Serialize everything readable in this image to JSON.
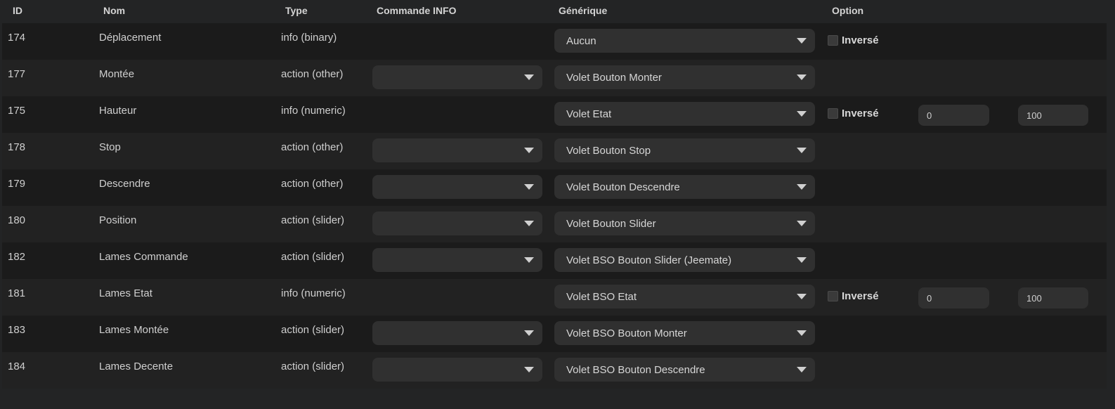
{
  "headers": {
    "id": "ID",
    "nom": "Nom",
    "type": "Type",
    "commande": "Commande INFO",
    "generique": "Générique",
    "option": "Option"
  },
  "rows": [
    {
      "id": "174",
      "nom": "Déplacement",
      "type": "info (binary)",
      "generique": "Aucun",
      "inverse_label": "Inversé"
    },
    {
      "id": "177",
      "nom": "Montée",
      "type": "action (other)",
      "commande": "",
      "generique": "Volet Bouton Monter"
    },
    {
      "id": "175",
      "nom": "Hauteur",
      "type": "info (numeric)",
      "generique": "Volet Etat",
      "inverse_label": "Inversé",
      "min": "0",
      "max": "100"
    },
    {
      "id": "178",
      "nom": "Stop",
      "type": "action (other)",
      "commande": "",
      "generique": "Volet Bouton Stop"
    },
    {
      "id": "179",
      "nom": "Descendre",
      "type": "action (other)",
      "commande": "",
      "generique": "Volet Bouton Descendre"
    },
    {
      "id": "180",
      "nom": "Position",
      "type": "action (slider)",
      "commande": "",
      "generique": "Volet Bouton Slider"
    },
    {
      "id": "182",
      "nom": "Lames Commande",
      "type": "action (slider)",
      "commande": "",
      "generique": "Volet BSO Bouton Slider (Jeemate)"
    },
    {
      "id": "181",
      "nom": "Lames Etat",
      "type": "info (numeric)",
      "generique": "Volet BSO Etat",
      "inverse_label": "Inversé",
      "min": "0",
      "max": "100"
    },
    {
      "id": "183",
      "nom": "Lames Montée",
      "type": "action (slider)",
      "commande": "",
      "generique": "Volet BSO Bouton Monter"
    },
    {
      "id": "184",
      "nom": "Lames Decente",
      "type": "action (slider)",
      "commande": "",
      "generique": "Volet BSO Bouton Descendre"
    }
  ]
}
